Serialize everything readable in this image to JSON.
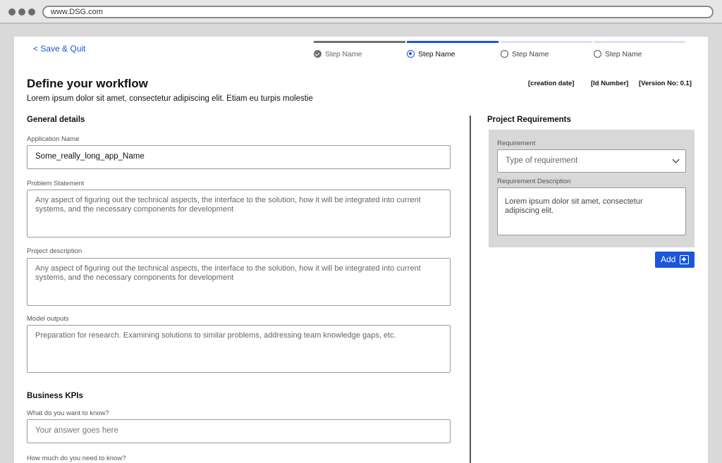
{
  "browser": {
    "url": "www.DSG.com"
  },
  "header": {
    "save_quit": "< Save & Quit"
  },
  "stepper": {
    "steps": [
      {
        "label": "Step Name",
        "state": "done"
      },
      {
        "label": "Step Name",
        "state": "active"
      },
      {
        "label": "Step Name",
        "state": "todo"
      },
      {
        "label": "Step Name",
        "state": "todo"
      }
    ]
  },
  "page": {
    "title": "Define your workflow",
    "subtitle": "Lorem ipsum dolor sit amet, consectetur adipiscing elit. Etiam eu turpis molestie",
    "meta": {
      "creation_date": "[creation date]",
      "id_number": "[Id Number]",
      "version": "[Version No: 0.1]"
    }
  },
  "general": {
    "heading": "General details",
    "app_name": {
      "label": "Application Name",
      "value": "Some_really_long_app_Name"
    },
    "problem_statement": {
      "label": "Problem Statement",
      "placeholder": "Any aspect of figuring out the technical aspects, the interface to the solution, how it will be integrated into current systems, and the necessary components for development"
    },
    "project_description": {
      "label": "Project description",
      "placeholder": "Any aspect of figuring out the technical aspects, the interface to the solution, how it will be integrated into current systems, and the necessary components for development"
    },
    "model_outputs": {
      "label": "Model outputs",
      "placeholder": "Preparation for research. Examining solutions to similar problems, addressing team knowledge gaps, etc."
    }
  },
  "kpis": {
    "heading": "Business KPIs",
    "q1": {
      "label": "What do you want to know?",
      "placeholder": "Your answer goes here"
    },
    "q2": {
      "label": "How much do you need to know?"
    }
  },
  "requirements": {
    "heading": "Project Requirements",
    "requirement": {
      "label": "Requirement",
      "placeholder": "Type of requirement"
    },
    "description": {
      "label": "Requirement Description",
      "value": "Lorem ipsum dolor sit amet, consectetur adipiscing elit."
    },
    "add_label": "Add"
  },
  "colors": {
    "accent": "#1a56db",
    "step_done": "#707070",
    "step_todo": "#dbe4f3",
    "panel_bg": "#d8d8d8"
  }
}
